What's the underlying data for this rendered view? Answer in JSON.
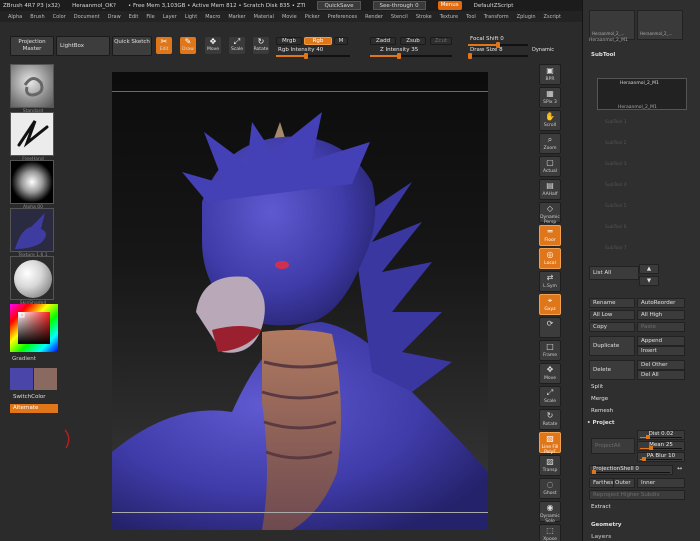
{
  "titlebar": {
    "app": "ZBrush 4R7 P3 (x32)",
    "document": "Heraanmol_OK?",
    "free_mem": "• Free Mem 3,103GB • Active Mem 812 • Scratch Disk 835 • ZTI",
    "quicksave": "QuickSave",
    "see_through": "See-through 0",
    "menus": "Menus",
    "default_zscript": "DefaultZScript"
  },
  "menubar": [
    "Alpha",
    "Brush",
    "Color",
    "Document",
    "Draw",
    "Edit",
    "File",
    "Layer",
    "Light",
    "Macro",
    "Marker",
    "Material",
    "Movie",
    "Picker",
    "Preferences",
    "Render",
    "Stencil",
    "Stroke",
    "Texture",
    "Tool",
    "Transform",
    "Zplugin",
    "Zscript"
  ],
  "toolbar": {
    "projection_master": "Projection Master",
    "lightbox": "LightBox",
    "quick_sketch": "Quick Sketch",
    "edit": "Edit",
    "draw": "Draw",
    "move": "Move",
    "scale": "Scale",
    "rotate": "Rotate",
    "mrgb": "Mrgb",
    "rgb": "Rgb",
    "m": "M",
    "rgb_intensity_label": "Rgb Intensity 40",
    "rgb_intensity_value": 40,
    "zadd": "Zadd",
    "zsub": "Zsub",
    "zcut": "Zcut",
    "z_intensity_label": "Z Intensity 35",
    "z_intensity_value": 35,
    "focal_shift_label": "Focal Shift 0",
    "focal_shift_value": 0,
    "draw_size_label": "Draw Size 8",
    "draw_size_value": 8,
    "dynamic": "Dynamic"
  },
  "leftshelf": {
    "brush1": "Standard",
    "stroke": "FreeHand",
    "alpha": "Alpha 00",
    "texture": "Texture 1.6 1",
    "material": "SkinShade4",
    "gradient": "Gradient",
    "switch_color": "SwitchColor",
    "alternate": "Alternate",
    "main_color": "#4a45a8",
    "secondary_color": "#8a6a60"
  },
  "rightshelf": [
    {
      "icon": "bpr-icon",
      "label": "BPR"
    },
    {
      "icon": "spix-icon",
      "label": "SPix 3"
    },
    {
      "icon": "scroll-icon",
      "label": "Scroll"
    },
    {
      "icon": "zoom-icon",
      "label": "Zoom"
    },
    {
      "icon": "actual-icon",
      "label": "Actual"
    },
    {
      "icon": "aahalf-icon",
      "label": "AAHalf"
    },
    {
      "icon": "persp-icon",
      "label": "Dynamic Persp"
    },
    {
      "icon": "floor-icon",
      "label": "Floor"
    },
    {
      "icon": "local-icon",
      "label": "Local"
    },
    {
      "icon": "lsym-icon",
      "label": "L.Sym"
    },
    {
      "icon": "xyz-icon",
      "label": "Gxyz"
    },
    {
      "icon": "rotate-icon",
      "label": ""
    },
    {
      "icon": "frame-icon",
      "label": "Frame"
    },
    {
      "icon": "move-icon",
      "label": "Move"
    },
    {
      "icon": "scale-icon",
      "label": "Scale"
    },
    {
      "icon": "rotate2-icon",
      "label": "Rotate"
    },
    {
      "icon": "linefill-icon",
      "label": "Line Fill PolyF"
    },
    {
      "icon": "transp-icon",
      "label": "Transp"
    },
    {
      "icon": "ghost-icon",
      "label": "Ghost"
    },
    {
      "icon": "solo-icon",
      "label": "Dynamic Solo"
    },
    {
      "icon": "xpose-icon",
      "label": "Xpose"
    }
  ],
  "palette": {
    "tool_thumbs": [
      "Heraanmol_2_...",
      "Heraanmol_2_..."
    ],
    "tool_name": "Heraanmol_2_M1",
    "subtool_header": "SubTool",
    "subtool_active": "Heraanmol_2_M1",
    "subtool_sub": "Heraanmol_2_M1",
    "subtool_slots": [
      "SubTool 1",
      "SubTool 2",
      "SubTool 3",
      "SubTool 4",
      "SubTool 5",
      "SubTool 6",
      "SubTool 7"
    ],
    "list_all": "List All",
    "up_arrow": "▲",
    "down_arrow": "▼",
    "rename": "Rename",
    "autoreorder": "AutoReorder",
    "all_low": "All Low",
    "all_high": "All High",
    "copy": "Copy",
    "paste": "Paste",
    "duplicate": "Duplicate",
    "append": "Append",
    "insert": "Insert",
    "delete": "Delete",
    "del_other": "Del Other",
    "del_all": "Del All",
    "split": "Split",
    "merge": "Merge",
    "remesh": "Remesh",
    "project": "Project",
    "project_all": "ProjectAll",
    "dist_label": "Dist 0.02",
    "dist_value": 0.02,
    "mean_label": "Mean 25",
    "mean_value": 25,
    "pa_blur_label": "PA Blur 10",
    "pa_blur_value": 10,
    "projection_shell_label": "ProjectionShell 0",
    "projection_shell_value": 0,
    "farthest": "Farthest",
    "outer": "Outer",
    "inner": "Inner",
    "reproject_higher": "Reproject Higher Subdiv",
    "extract": "Extract",
    "geometry": "Geometry",
    "layers": "Layers"
  }
}
